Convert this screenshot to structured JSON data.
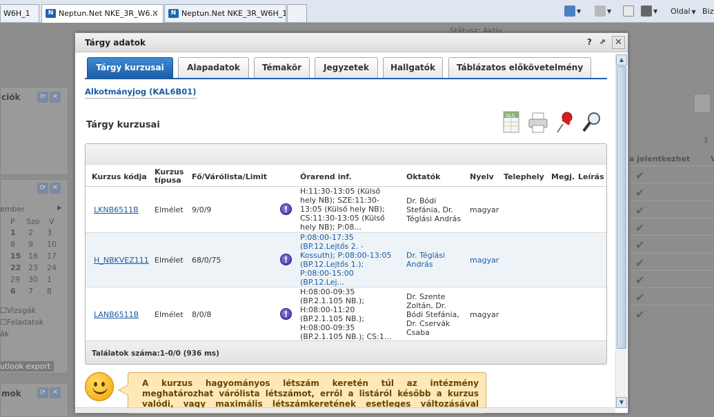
{
  "browser": {
    "tabs": [
      {
        "label": "W6H_1"
      },
      {
        "label": "Neptun.Net NKE_3R_W6..."
      },
      {
        "label": "Neptun.Net NKE_3R_W6H_1"
      }
    ],
    "commands": {
      "page_label": "Oldal",
      "safety_label": "Bizt"
    }
  },
  "background": {
    "panel1_title": "ciók",
    "calendar": {
      "month": "ember",
      "days_header": [
        "P",
        "Szo",
        "V"
      ],
      "rows": [
        [
          "1",
          "2",
          "3"
        ],
        [
          "8",
          "9",
          "10"
        ],
        [
          "15",
          "16",
          "17"
        ],
        [
          "22",
          "23",
          "24"
        ],
        [
          "29",
          "30",
          "1"
        ],
        [
          "6",
          "7",
          "8"
        ]
      ]
    },
    "links": [
      "Vizsgák",
      "Feladatok",
      "ák"
    ],
    "outlook_export": "utlook export",
    "panel3_title": "mok",
    "right_header": "a jelentkezhet",
    "right_header2": "V",
    "page_num": "1",
    "top_text": "Státusz: Aktív"
  },
  "dialog": {
    "title": "Tárgy adatok",
    "help_label": "?",
    "tabs": [
      {
        "label": "Tárgy kurzusai",
        "active": true
      },
      {
        "label": "Alapadatok"
      },
      {
        "label": "Témakör"
      },
      {
        "label": "Jegyzetek"
      },
      {
        "label": "Hallgatók"
      },
      {
        "label": "Táblázatos előkövetelmény"
      }
    ],
    "subject": "Alkotmányjog (KAL6B01)",
    "section_title": "Tárgy kurzusai",
    "toolbar": {
      "export_label": "XLS"
    },
    "table": {
      "headers": {
        "code": "Kurzus kódja",
        "type": "Kurzus típusa",
        "count": "Fő/Várólista/Limit",
        "schedule": "Órarend inf.",
        "teachers": "Oktatók",
        "language": "Nyelv",
        "site": "Telephely",
        "note": "Megj.",
        "desc": "Leírás"
      },
      "rows": [
        {
          "code": "LKNB6511B",
          "type": "Elmélet",
          "count": "9/0/9",
          "schedule": [
            "H:11:30-13:05 (Külső",
            "hely NB); SZE:11:30-",
            "13:05 (Külső hely NB);",
            "CS:11:30-13:05 (Külső",
            "hely NB); P:08..."
          ],
          "teachers": [
            "Dr. Bódi",
            "Stefánia, Dr.",
            "Téglási András"
          ],
          "language": "magyar"
        },
        {
          "code": "H_NBKVEZ111",
          "type": "Elmélet",
          "count": "68/0/75",
          "schedule": [
            "P:08:00-17:35",
            "(BP.12.Lejtős 2. -",
            "Kossuth); P:08:00-13:05",
            "(BP.12.Lejtős 1.);",
            "P:08:00-15:00",
            "(BP.12.Lej..."
          ],
          "teachers": [
            "Dr. Téglási",
            "András"
          ],
          "language": "magyar"
        },
        {
          "code": "LANB6511B",
          "type": "Elmélet",
          "count": "8/0/8",
          "schedule": [
            "H:08:00-09:35",
            "(BP.2.1.105 NB.);",
            "H:08:00-11:20",
            "(BP.2.1.105 NB.);",
            "H:08:00-09:35",
            "(BP.2.1.105 NB.); CS:1..."
          ],
          "teachers": [
            "Dr. Szente",
            "Zoltán, Dr.",
            "Bódi Stefánia,",
            "Dr. Cservák",
            "Csaba"
          ],
          "language": "magyar"
        }
      ],
      "footer": "Találatok száma:1-0/0 (936 ms)"
    },
    "hint": "A kurzus hagyományos létszám keretén túl az intézmény meghatározhat várólista létszámot, erről a listáról később a kurzus valódi, vagy maximális létszámkeretének esetleges változásával lehetősége van"
  },
  "colors": {
    "accent": "#1e5da5",
    "link": "#1a5aa0",
    "hint_bg": "#fde9b8"
  }
}
